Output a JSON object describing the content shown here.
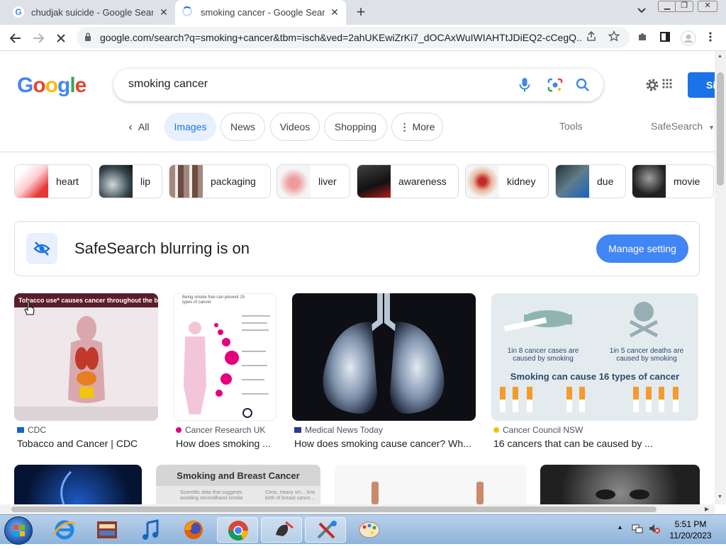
{
  "browser": {
    "tabs": [
      {
        "title": "chudjak suicide - Google Search",
        "close": "✕"
      },
      {
        "title": "smoking cancer - Google Search",
        "close": "✕"
      }
    ],
    "new_tab": "+",
    "url": "google.com/search?q=smoking+cancer&tbm=isch&ved=2ahUKEwiZrKi7_dOCAxWuIWIAHTtJDiEQ2-cCegQ..."
  },
  "google": {
    "logo": [
      "G",
      "o",
      "o",
      "g",
      "l",
      "e"
    ],
    "logo_colors": [
      "#4285f4",
      "#ea4335",
      "#fbbc05",
      "#4285f4",
      "#34a853",
      "#ea4335"
    ],
    "query": "smoking cancer",
    "sign_in": "Sign in",
    "tabs": {
      "all": "All",
      "images": "Images",
      "news": "News",
      "videos": "Videos",
      "shopping": "Shopping",
      "more": "More"
    },
    "tools": "Tools",
    "safesearch": "SafeSearch"
  },
  "related_chips": [
    {
      "label": "heart",
      "color": "#c62828"
    },
    {
      "label": "lip",
      "color": "#37474f"
    },
    {
      "label": "packaging",
      "color": "#8d6e63"
    },
    {
      "label": "liver",
      "color": "#e57373"
    },
    {
      "label": "awareness",
      "color": "#212121"
    },
    {
      "label": "kidney",
      "color": "#d7a98a"
    },
    {
      "label": "due",
      "color": "#455a64"
    },
    {
      "label": "movie",
      "color": "#424242"
    }
  ],
  "safesearch_banner": {
    "text": "SafeSearch blurring is on",
    "button": "Manage setting"
  },
  "results": [
    {
      "source": "CDC",
      "title": "Tobacco and Cancer | CDC",
      "image_heading": "Tobacco use* causes cancer throughout the body."
    },
    {
      "source": "Cancer Research UK",
      "title": "How does smoking ...",
      "image_heading": "Being smoke free can prevent 15 types of cancer"
    },
    {
      "source": "Medical News Today",
      "title": "How does smoking cause cancer? Wh..."
    },
    {
      "source": "Cancer Council NSW",
      "title": "16 cancers that can be caused by ...",
      "stat1": "1in 8 cancer cases are caused by smoking",
      "stat2": "1in 5 cancer deaths are caused by smoking",
      "caption": "Smoking can cause 16 types of cancer"
    }
  ],
  "second_row": {
    "breast_title": "Smoking and Breast Cancer",
    "breast_sub1": "Scientific data that suggests avoiding secondhand smoke",
    "breast_sub2": "Clinic, heavy sm... first birth of breast cance..."
  },
  "taskbar": {
    "time": "5:51 PM",
    "date": "11/20/2023"
  }
}
